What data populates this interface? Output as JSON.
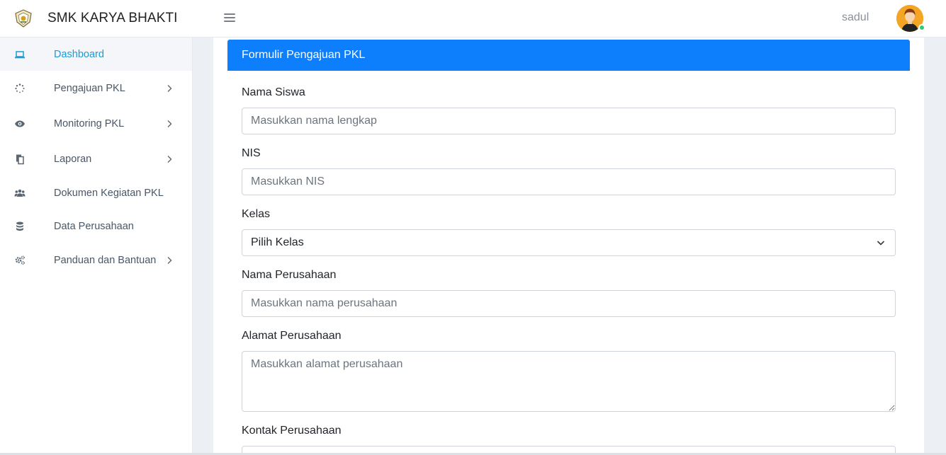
{
  "brand": {
    "name": "SMK KARYA BHAKTI",
    "logo_icon": "school-crest-icon"
  },
  "header": {
    "menu_icon": "hamburger-icon",
    "username": "sadul",
    "avatar_status_color": "#2ecc71"
  },
  "sidebar": {
    "items": [
      {
        "label": "Dashboard",
        "icon": "laptop-icon",
        "active": true,
        "has_submenu": false
      },
      {
        "label": "Pengajuan PKL",
        "icon": "spinner-icon",
        "active": false,
        "has_submenu": true
      },
      {
        "label": "Monitoring PKL",
        "icon": "eye-icon",
        "active": false,
        "has_submenu": true
      },
      {
        "label": "Laporan",
        "icon": "copy-icon",
        "active": false,
        "has_submenu": true
      },
      {
        "label": "Dokumen Kegiatan PKL",
        "icon": "users-icon",
        "active": false,
        "has_submenu": false
      },
      {
        "label": "Data Perusahaan",
        "icon": "database-icon",
        "active": false,
        "has_submenu": false
      },
      {
        "label": "Panduan dan Bantuan",
        "icon": "cogs-icon",
        "active": false,
        "has_submenu": true
      }
    ]
  },
  "form": {
    "title": "Formulir Pengajuan PKL",
    "nama_siswa": {
      "label": "Nama Siswa",
      "placeholder": "Masukkan nama lengkap",
      "value": ""
    },
    "nis": {
      "label": "NIS",
      "placeholder": "Masukkan NIS",
      "value": ""
    },
    "kelas": {
      "label": "Kelas",
      "selected": "Pilih Kelas"
    },
    "nama_perusahaan": {
      "label": "Nama Perusahaan",
      "placeholder": "Masukkan nama perusahaan",
      "value": ""
    },
    "alamat_perusahaan": {
      "label": "Alamat Perusahaan",
      "placeholder": "Masukkan alamat perusahaan",
      "value": ""
    },
    "kontak_perusahaan": {
      "label": "Kontak Perusahaan"
    }
  },
  "colors": {
    "primary": "#0d7efc",
    "active_nav": "#1a9bd7",
    "avatar_bg": "#f5a524"
  }
}
